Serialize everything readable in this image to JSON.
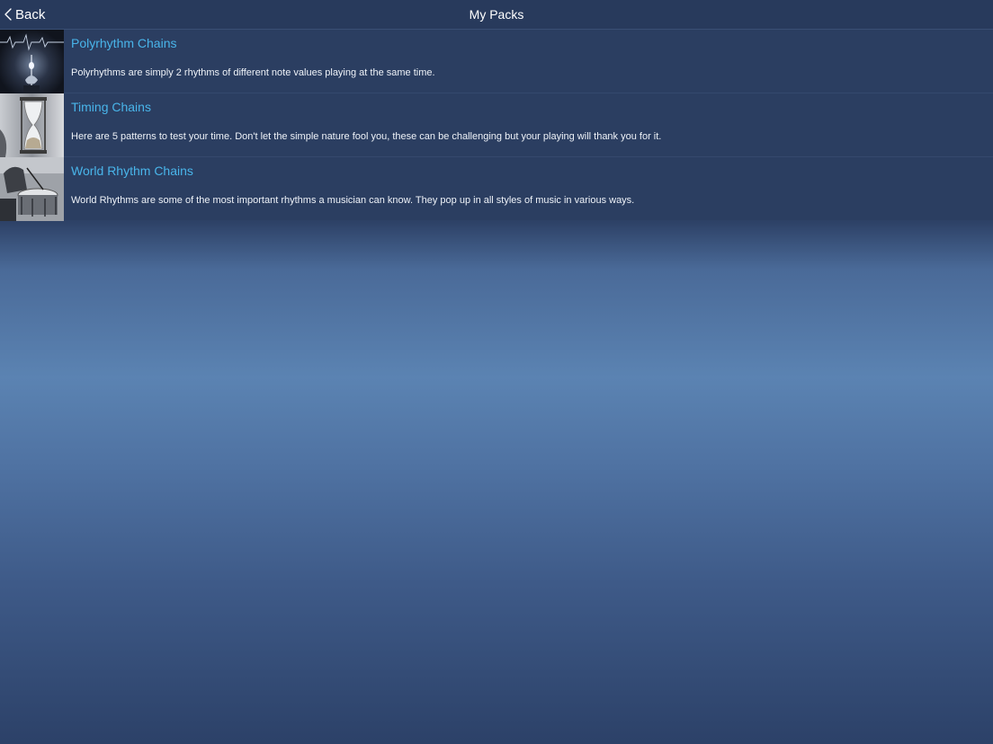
{
  "navbar": {
    "back_label": "Back",
    "title": "My Packs"
  },
  "packs": [
    {
      "title": "Polyrhythm Chains",
      "description": "Polyrhythms are simply 2 rhythms of different note values playing at the same time.",
      "thumbnail": "metronome-heartbeat-image"
    },
    {
      "title": "Timing Chains",
      "description": "Here are 5 patterns to test your time.  Don't let the simple nature fool you, these can be challenging but your playing will thank you for it.",
      "thumbnail": "hourglass-image"
    },
    {
      "title": "World Rhythm Chains",
      "description": "World Rhythms are some of the most important rhythms a musician can know.  They pop up in all styles of music in various ways.",
      "thumbnail": "drummer-image"
    }
  ],
  "colors": {
    "title_accent": "#49b5ea",
    "row_bg": "#2b3e61",
    "navbar_bg": "#283a5c"
  }
}
